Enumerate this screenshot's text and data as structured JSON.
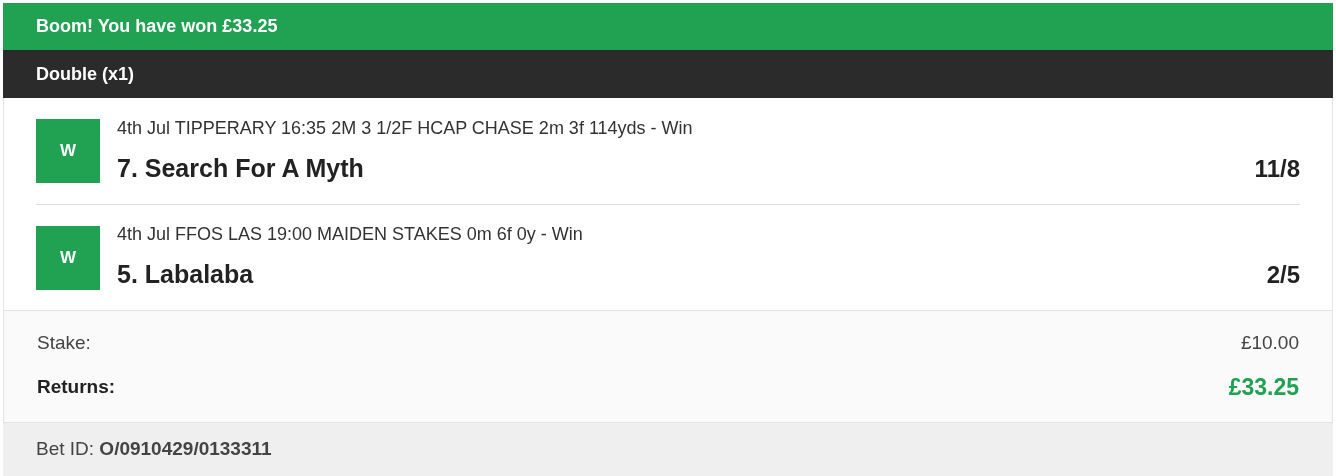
{
  "banner": {
    "text": "Boom! You have won £33.25"
  },
  "bet_type": {
    "text": "Double (x1)"
  },
  "legs": [
    {
      "result": "W",
      "event": "4th Jul TIPPERARY 16:35 2M 3 1/2F HCAP CHASE 2m 3f 114yds - Win",
      "selection": "7. Search For A Myth",
      "odds": "11/8"
    },
    {
      "result": "W",
      "event": "4th Jul FFOS LAS 19:00 MAIDEN STAKES 0m 6f 0y - Win",
      "selection": "5. Labalaba",
      "odds": "2/5"
    }
  ],
  "summary": {
    "stake_label": "Stake:",
    "stake": "£10.00",
    "returns_label": "Returns:",
    "returns": "£33.25"
  },
  "bet_id": "Bet ID: **O/0910429/0133311**"
}
